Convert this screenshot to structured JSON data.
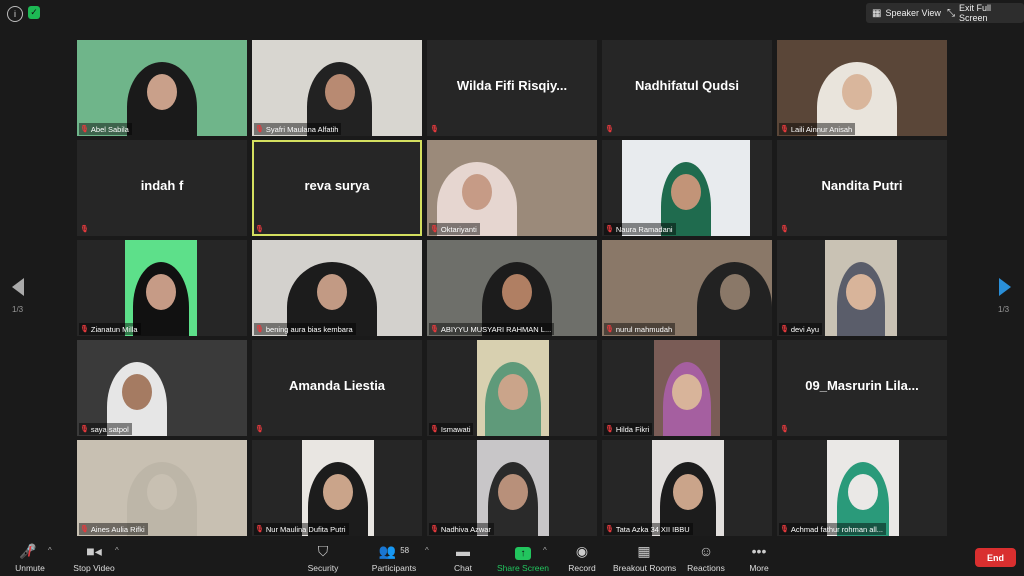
{
  "topbar": {
    "speaker_view": "Speaker View",
    "exit_full_screen": "Exit Full Screen"
  },
  "navigation": {
    "page_left": "1/3",
    "page_right": "1/3"
  },
  "participants": [
    {
      "name": "Abel Sabila",
      "display": "video"
    },
    {
      "name": "Syafri Maulana Alfatih",
      "display": "video"
    },
    {
      "name": "Wilda Fifi Risqiy...",
      "display": "name"
    },
    {
      "name": "Nadhifatul Qudsi",
      "display": "name"
    },
    {
      "name": "Laili Ainnur Anisah",
      "display": "video"
    },
    {
      "name": "indah f",
      "display": "name"
    },
    {
      "name": "reva surya",
      "display": "name",
      "active_speaker": true
    },
    {
      "name": "Oktariyanti",
      "display": "video"
    },
    {
      "name": "Naura Ramadani",
      "display": "video"
    },
    {
      "name": "Nandita Putri",
      "display": "name"
    },
    {
      "name": "Zianatun Milla",
      "display": "video"
    },
    {
      "name": "bening aura bias kembara",
      "display": "video"
    },
    {
      "name": "ABIYYU MUSYARI RAHMAN L...",
      "display": "video"
    },
    {
      "name": "nurul mahmudah",
      "display": "video"
    },
    {
      "name": "devi Ayu",
      "display": "video"
    },
    {
      "name": "saya satpol",
      "display": "video"
    },
    {
      "name": "Amanda Liestia",
      "display": "name"
    },
    {
      "name": "Ismawati",
      "display": "video"
    },
    {
      "name": "Hilda Fikri",
      "display": "video"
    },
    {
      "name": "09_Masrurin  Lila...",
      "display": "name"
    },
    {
      "name": "Aines Aulia Rifki",
      "display": "video"
    },
    {
      "name": "Nur Maulina Dufita Putri",
      "display": "video"
    },
    {
      "name": "Nadhiva Azwar",
      "display": "video"
    },
    {
      "name": "Tata Azka 34 XII IBBU",
      "display": "video"
    },
    {
      "name": "Achmad fathur rohman all...",
      "display": "video"
    }
  ],
  "toolbar": {
    "unmute": "Unmute",
    "stop_video": "Stop Video",
    "security": "Security",
    "participants": "Participants",
    "participants_count": "58",
    "chat": "Chat",
    "share_screen": "Share Screen",
    "record": "Record",
    "breakout_rooms": "Breakout Rooms",
    "reactions": "Reactions",
    "more": "More",
    "end": "End"
  },
  "colors": {
    "active_speaker_border": "#d4df5f",
    "share_green": "#22c55e",
    "end_red": "#d92f2f",
    "mute_red": "#e5393d"
  }
}
